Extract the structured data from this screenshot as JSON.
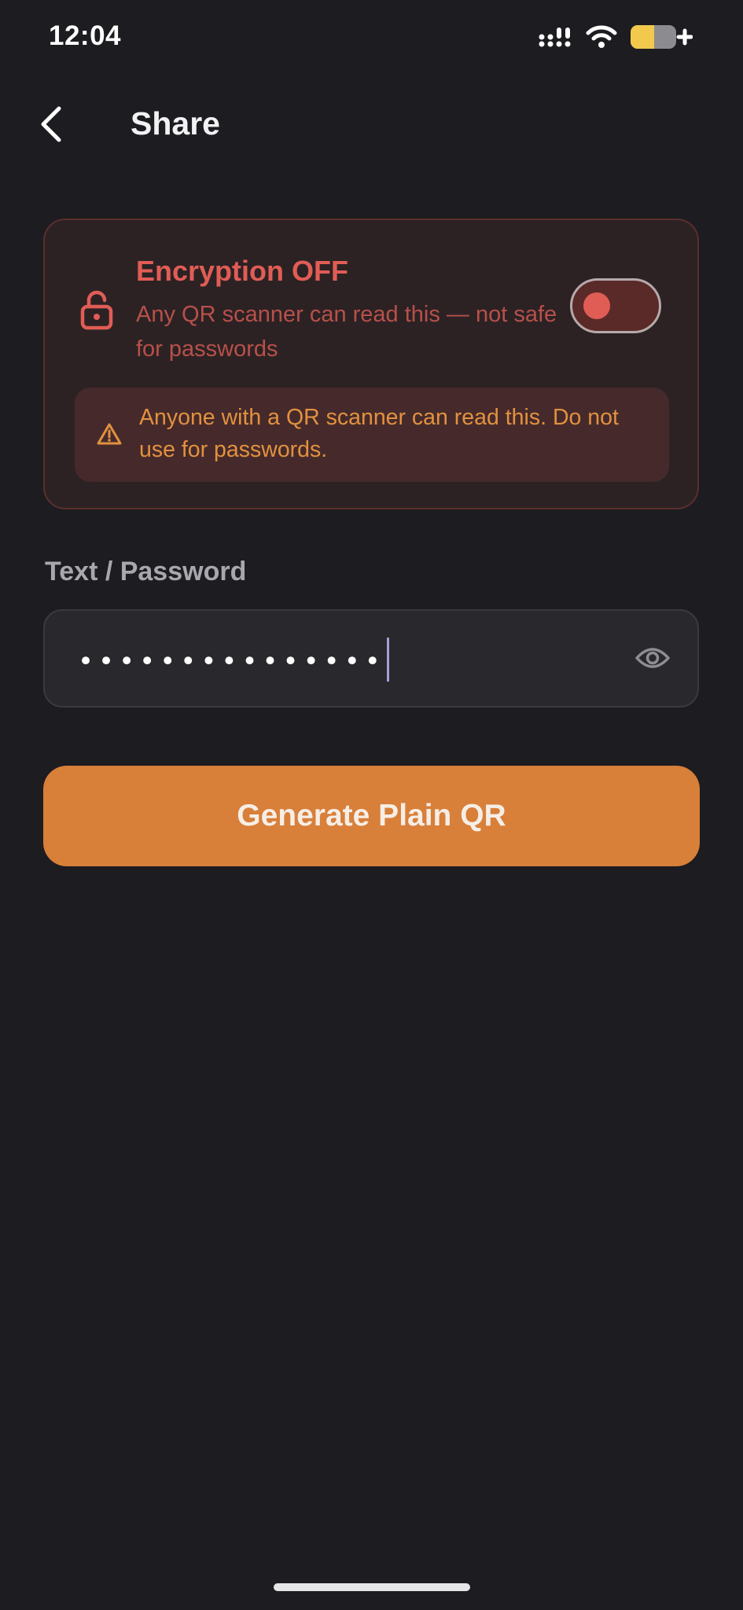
{
  "status_bar": {
    "time": "12:04",
    "icons": [
      "cellular-signal-icon",
      "wifi-icon",
      "battery-charging-icon"
    ]
  },
  "header": {
    "back_icon": "chevron-left-icon",
    "title": "Share"
  },
  "encryption": {
    "icon": "unlocked-padlock-icon",
    "title": "Encryption OFF",
    "description": "Any QR scanner can read this — not safe for passwords",
    "toggle_on": false,
    "warning_icon": "warning-triangle-icon",
    "warning_text": "Anyone with a QR scanner can read this. Do not use for passwords."
  },
  "password_field": {
    "label": "Text / Password",
    "masked_value": "•••••••••••••••",
    "visibility_icon": "eye-icon"
  },
  "generate_button": {
    "label": "Generate Plain QR"
  },
  "colors": {
    "background": "#1d1c20",
    "danger": "#e05d55",
    "warning": "#e2913f",
    "accent": "#d87f3a"
  }
}
